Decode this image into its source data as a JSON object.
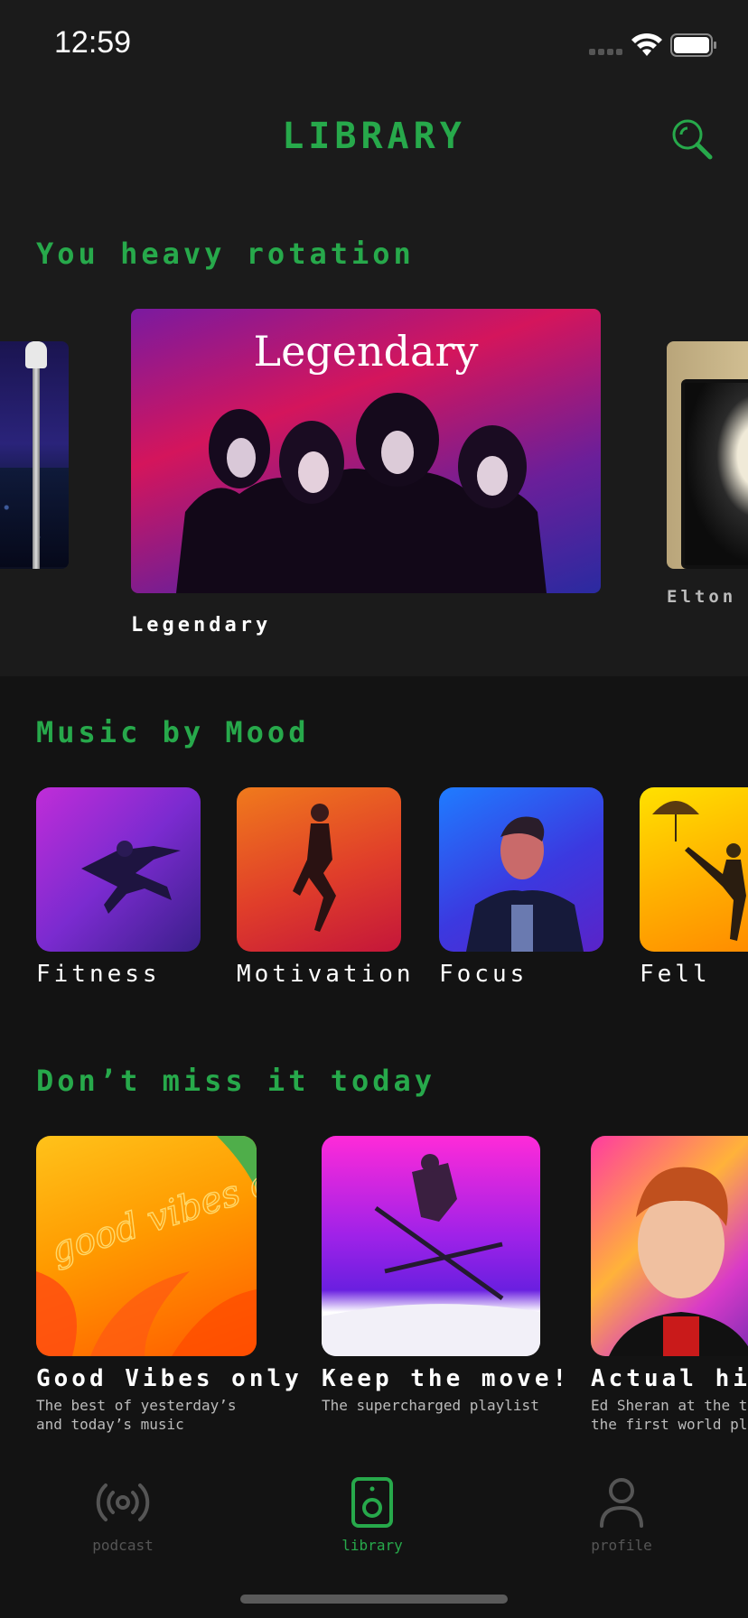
{
  "status_bar": {
    "time": "12:59"
  },
  "header": {
    "title": "LIBRARY",
    "search_icon": "search-icon"
  },
  "heavy_rotation": {
    "title": "You heavy rotation",
    "items": [
      {
        "label": ""
      },
      {
        "label": "Legendary",
        "cover_text": "Legendary"
      },
      {
        "label": "Elton J"
      }
    ]
  },
  "mood": {
    "title": "Music by Mood",
    "items": [
      {
        "label": "Fitness"
      },
      {
        "label": "Motivation"
      },
      {
        "label": "Focus"
      },
      {
        "label": "Fell"
      }
    ]
  },
  "dont_miss": {
    "title": "Don’t miss it today",
    "items": [
      {
        "title": "Good Vibes only",
        "subtitle_line1": "The best of yesterday’s",
        "subtitle_line2": "and today’s music",
        "cover_text": "good vibes only"
      },
      {
        "title": "Keep the move!",
        "subtitle_line1": "The supercharged playlist",
        "subtitle_line2": ""
      },
      {
        "title": "Actual hit",
        "subtitle_line1": "Ed Sheran at the t",
        "subtitle_line2": "the first world pl"
      }
    ]
  },
  "tab_bar": {
    "tabs": [
      {
        "label": "podcast",
        "icon": "broadcast-icon",
        "active": false
      },
      {
        "label": "library",
        "icon": "speaker-icon",
        "active": true
      },
      {
        "label": "profile",
        "icon": "person-icon",
        "active": false
      }
    ]
  },
  "colors": {
    "accent": "#27a94b",
    "background": "#1b1b1b",
    "section_background": "#131313",
    "inactive": "#555555"
  }
}
